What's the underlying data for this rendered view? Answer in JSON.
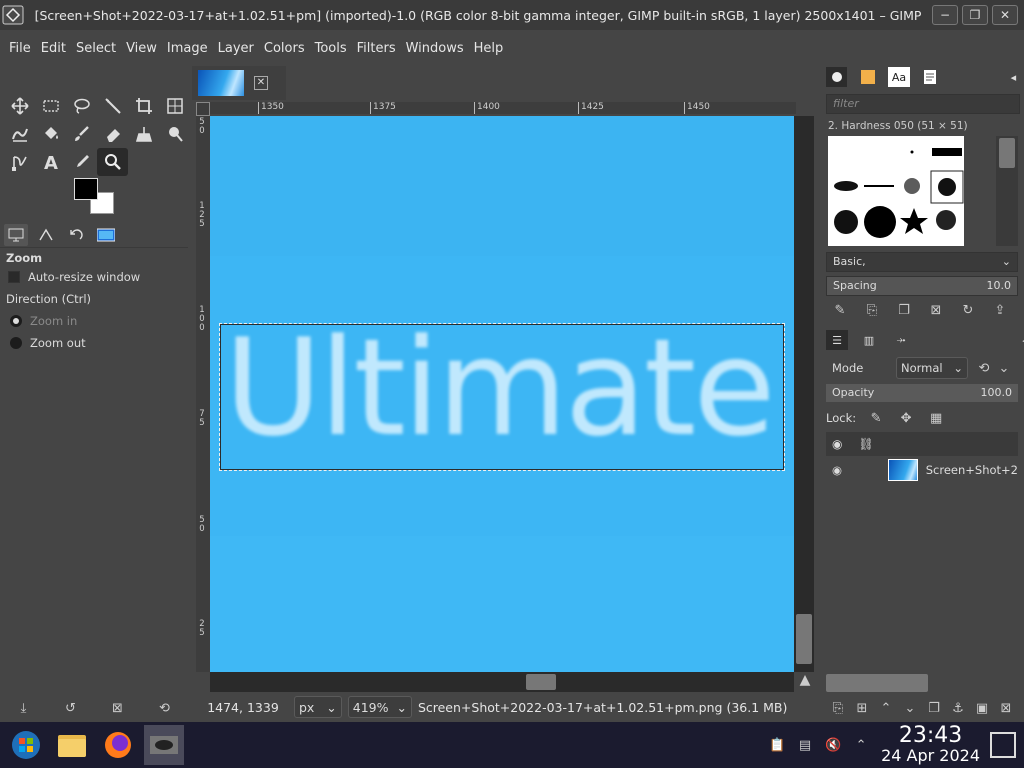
{
  "window": {
    "title": "[Screen+Shot+2022-03-17+at+1.02.51+pm] (imported)-1.0 (RGB color 8-bit gamma integer, GIMP built-in sRGB, 1 layer) 2500x1401 – GIMP",
    "btn_minimize": "−",
    "btn_maximize": "❐",
    "btn_close": "✕"
  },
  "menu": [
    "File",
    "Edit",
    "Select",
    "View",
    "Image",
    "Layer",
    "Colors",
    "Tools",
    "Filters",
    "Windows",
    "Help"
  ],
  "tool_options": {
    "title": "Zoom",
    "auto_resize": "Auto-resize window",
    "direction_label": "Direction  (Ctrl)",
    "zoom_in": "Zoom in",
    "zoom_out": "Zoom out"
  },
  "ruler": {
    "top_ticks": [
      "1350",
      "1375",
      "1400",
      "1425",
      "1450"
    ],
    "left_labels": [
      "5\n0",
      "1\n2\n5",
      "1\n0\n0",
      "7\n5",
      "5\n0",
      "2\n5",
      "0"
    ]
  },
  "canvas": {
    "text": "Ultimate",
    "bg_color": "#3db6f4"
  },
  "status": {
    "coords": "1474, 1339",
    "unit": "px",
    "zoom": "419%",
    "file": "Screen+Shot+2022-03-17+at+1.02.51+pm.png (36.1 MB)"
  },
  "brushes": {
    "filter_placeholder": "filter",
    "selected": "2. Hardness 050 (51 × 51)",
    "set": "Basic,",
    "spacing_label": "Spacing",
    "spacing_value": "10.0"
  },
  "layers": {
    "mode_label": "Mode",
    "mode_value": "Normal",
    "opacity_label": "Opacity",
    "opacity_value": "100.0",
    "lock_label": "Lock:",
    "layer_name": "Screen+Shot+2"
  },
  "clock": {
    "time": "23:43",
    "date": "24 Apr 2024"
  }
}
